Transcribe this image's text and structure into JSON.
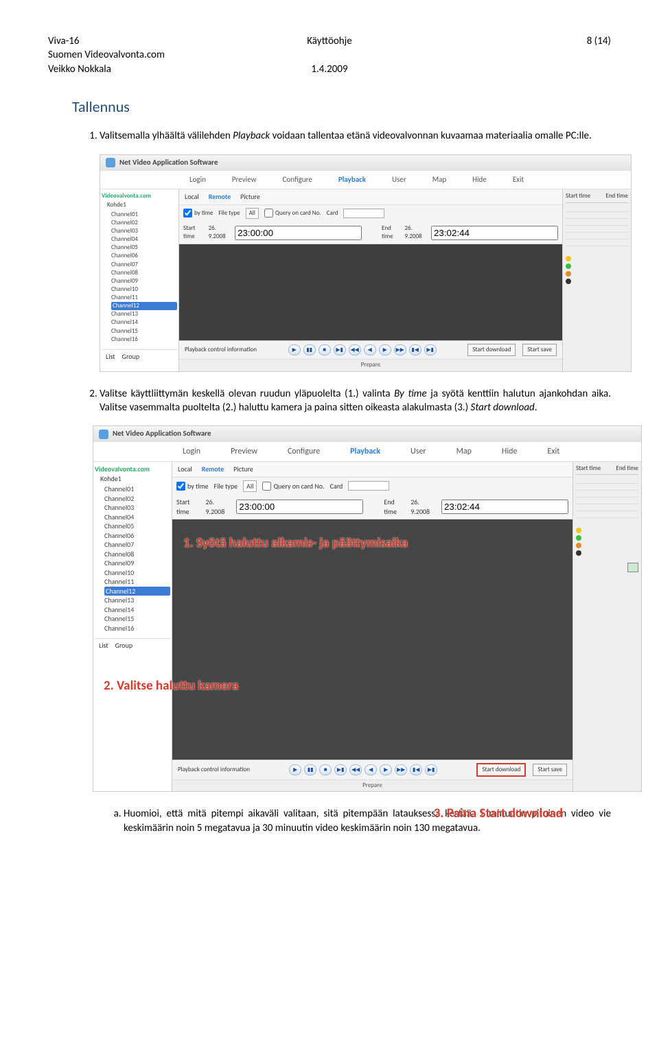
{
  "header": {
    "app": "Viva-16",
    "company": "Suomen Videovalvonta.com",
    "author": "Veikko Nokkala",
    "docTitle": "Käyttöohje",
    "date": "1.4.2009",
    "pageInfo": "8 (14)"
  },
  "section": {
    "title": "Tallennus"
  },
  "steps": {
    "s1": {
      "p1": "Valitsemalla ylhäältä välilehden ",
      "em": "Playback",
      "p2": " voidaan tallentaa etänä videovalvonnan kuvaamaa materiaalia omalle PC:lle."
    },
    "s2": {
      "p1": "Valitse käyttliittymän keskellä olevan ruudun yläpuolelta (1.) valinta ",
      "em1": "By time",
      "p2": " ja syötä kenttiin halutun ajankohdan aika. Valitse vasemmalta puoltelta (2.) haluttu kamera ja paina sitten oikeasta alakulmasta (3.) ",
      "em2": "Start download",
      "p3": "."
    },
    "subA": "Huomioi, että mitä pitempi aikaväli valitaan, sitä pitempään latauksessa kestää. 1 minuutin pituinen video vie keskimäärin noin 5 megatavua ja 30 minuutin video keskimäärin noin 130 megatavua."
  },
  "app": {
    "title": "Net Video Application Software",
    "menu": [
      "Login",
      "Preview",
      "Configure",
      "Playback",
      "User",
      "Map",
      "Hide",
      "Exit"
    ],
    "tabs": [
      "Local",
      "Remote",
      "Picture"
    ],
    "tree": {
      "root": "Videovalvonta.com",
      "folder": "Kohde1",
      "channels": [
        "Channel01",
        "Channel02",
        "Channel03",
        "Channel04",
        "Channel05",
        "Channel06",
        "Channel07",
        "Channel08",
        "Channel09",
        "Channel10",
        "Channel11",
        "Channel12",
        "Channel13",
        "Channel14",
        "Channel15",
        "Channel16"
      ],
      "selectedIndex": 11
    },
    "sidebarFoot": [
      "List",
      "Group"
    ],
    "filter": {
      "bytime": "by time",
      "filetypeLabel": "File type",
      "filetypeVal": "All",
      "queryLabel": "Query on card No.",
      "cardLabel": "Card"
    },
    "times": {
      "startLabel": "Start time",
      "startDate": "26. 9.2008",
      "startTime": "23:00:00",
      "endLabel": "End time",
      "endDate": "26. 9.2008",
      "endTime": "23:02:44"
    },
    "rightCols": {
      "c1": "Start time",
      "c2": "End time"
    },
    "footer": {
      "info": "Playback control information",
      "startDL": "Start download",
      "startSave": "Start save",
      "prepare": "Prepare"
    }
  },
  "overlays": {
    "o1": "1. Syötä haluttu alkamis- ja päättymisaika",
    "o2": "2. Valitse haluttu kamera",
    "o3": "3. Paina Start download"
  }
}
